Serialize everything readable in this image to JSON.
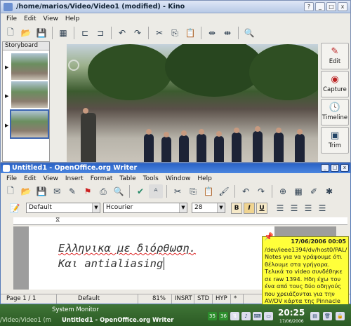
{
  "kino": {
    "title": "/home/marios/Video/Video1 (modified) - Kino",
    "window_controls": [
      "?",
      "_",
      "□",
      "x"
    ],
    "menu": [
      "File",
      "Edit",
      "View",
      "Help"
    ],
    "storyboard_label": "Storyboard",
    "side_buttons": [
      {
        "label": "Edit",
        "icon": "edit-icon"
      },
      {
        "label": "Capture",
        "icon": "capture-icon"
      },
      {
        "label": "Timeline",
        "icon": "clock-icon"
      },
      {
        "label": "Trim",
        "icon": "trim-icon"
      }
    ]
  },
  "writer": {
    "title": "Untitled1 - OpenOffice.org Writer",
    "menu": [
      "File",
      "Edit",
      "View",
      "Insert",
      "Format",
      "Table",
      "Tools",
      "Window",
      "Help"
    ],
    "paragraph_style": "Default",
    "font_name": "Hcourier",
    "font_size": "28",
    "format_buttons": [
      "B",
      "I",
      "U"
    ],
    "lines": [
      "Ελληνικα με διόρθωση.",
      "Και antialiasing"
    ],
    "status": {
      "page": "Page 1 / 1",
      "style": "Default",
      "zoom": "81%",
      "mode": "INSRT",
      "selection": "STD",
      "hyperlink": "HYP",
      "modified": "*"
    }
  },
  "note": {
    "date": "17/06/2006 00:05",
    "text": "/dev/ieee1394/dv/host0/PAL/ Notes για να γράψουμε ότι θέλουμε στα γρήγορα. Τελικά το video συνδέθηκε σε raw 1394. Ηδη έχω τον ένα από τους δύο οδηγούς που χρειάζονται για την AV/DV κάρτα της Pinnacle"
  },
  "taskbar": {
    "tasks": [
      "System Monitor",
      "/Video/Video1 (m",
      "Untitled1 - OpenOffice.org Writer"
    ],
    "tray_numbers": [
      "35",
      "36"
    ],
    "clock": "20:25",
    "date": "17/06/2006"
  },
  "colors": {
    "accent": "#2a62c5",
    "note_bg": "#ffff3a",
    "taskbar": "#2f6028"
  }
}
